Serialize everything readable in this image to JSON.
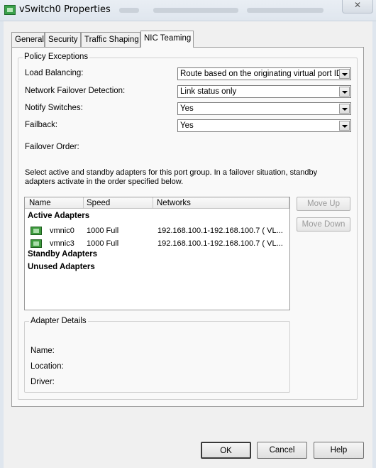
{
  "window": {
    "title": "vSwitch0 Properties",
    "close_glyph": "✕"
  },
  "tabs": [
    "General",
    "Security",
    "Traffic Shaping",
    "NIC Teaming"
  ],
  "active_tab": "NIC Teaming",
  "policy_exceptions": {
    "legend": "Policy Exceptions",
    "load_balancing": {
      "label": "Load Balancing:",
      "value": "Route based on the originating virtual port ID"
    },
    "failover_detection": {
      "label": "Network Failover Detection:",
      "value": "Link status only"
    },
    "notify_switches": {
      "label": "Notify Switches:",
      "value": "Yes"
    },
    "failback": {
      "label": "Failback:",
      "value": "Yes"
    },
    "failover_order_label": "Failover Order:",
    "description_line1": "Select active and standby adapters for this port group.  In a failover situation, standby",
    "description_line2": "adapters activate  in the order specified below."
  },
  "adapter_list": {
    "columns": [
      "Name",
      "Speed",
      "Networks"
    ],
    "active_header": "Active Adapters",
    "active_rows": [
      {
        "name": "vmnic0",
        "speed": "1000 Full",
        "networks": "192.168.100.1-192.168.100.7 ( VL..."
      },
      {
        "name": "vmnic3",
        "speed": "1000 Full",
        "networks": "192.168.100.1-192.168.100.7 ( VL..."
      }
    ],
    "standby_header": "Standby Adapters",
    "unused_header": "Unused Adapters"
  },
  "buttons": {
    "move_up": "Move Up",
    "move_down": "Move Down",
    "ok": "OK",
    "cancel": "Cancel",
    "help": "Help"
  },
  "adapter_details": {
    "legend": "Adapter Details",
    "name_label": "Name:",
    "location_label": "Location:",
    "driver_label": "Driver:"
  },
  "icons": {
    "app": "vswitch-icon",
    "nic": "network-adapter-icon",
    "dropdown": "chevron-down-icon"
  }
}
